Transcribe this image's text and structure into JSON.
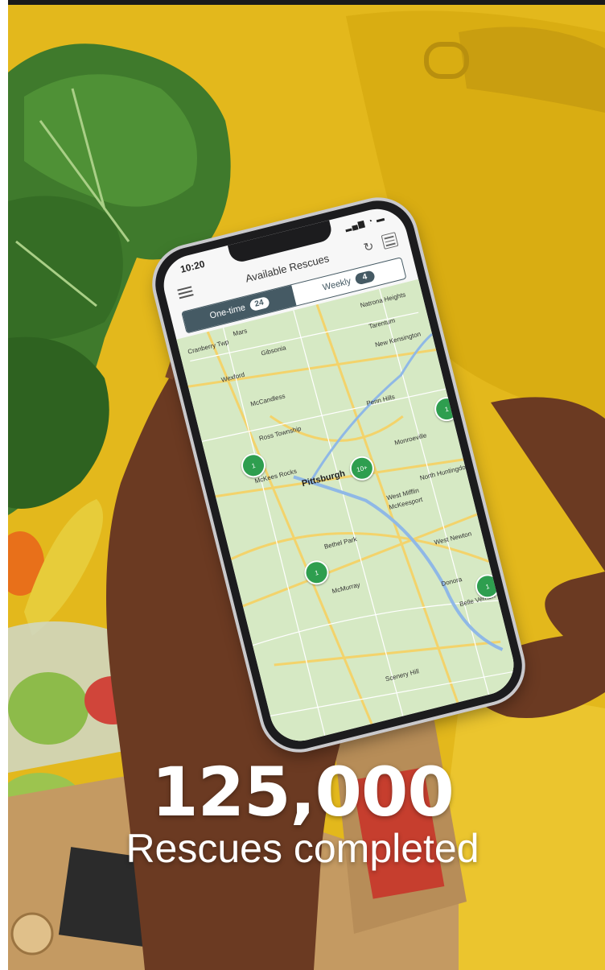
{
  "stat": {
    "number": "125,000",
    "label": "Rescues completed"
  },
  "phone": {
    "status_time": "10:20",
    "app_title": "Available Rescues",
    "tabs": [
      {
        "label": "One-time",
        "count": "24",
        "active": true
      },
      {
        "label": "Weekly",
        "count": "4",
        "active": false
      }
    ],
    "map_places": [
      "Cranberry Twp",
      "Mars",
      "Gibsonia",
      "Natrona Heights",
      "Tarentum",
      "Wexford",
      "New Kensington",
      "McCandless",
      "Ross Township",
      "Penn Hills",
      "McKees Rocks",
      "Pittsburgh",
      "Monroeville",
      "Bethel Park",
      "West Mifflin",
      "McKeesport",
      "North Huntingdon",
      "McMurray",
      "West Newton",
      "Donora",
      "Scenery Hill",
      "Belle Vernon"
    ],
    "pins": [
      "1",
      "10+",
      "1",
      "1",
      "1"
    ]
  },
  "colors": {
    "background": "#e3b81c",
    "pin": "#2e9e4f",
    "tab_active": "#455a64"
  },
  "icons": [
    "menu-icon",
    "refresh-icon",
    "list-icon",
    "location-arrow-icon",
    "map-pin-icon"
  ]
}
